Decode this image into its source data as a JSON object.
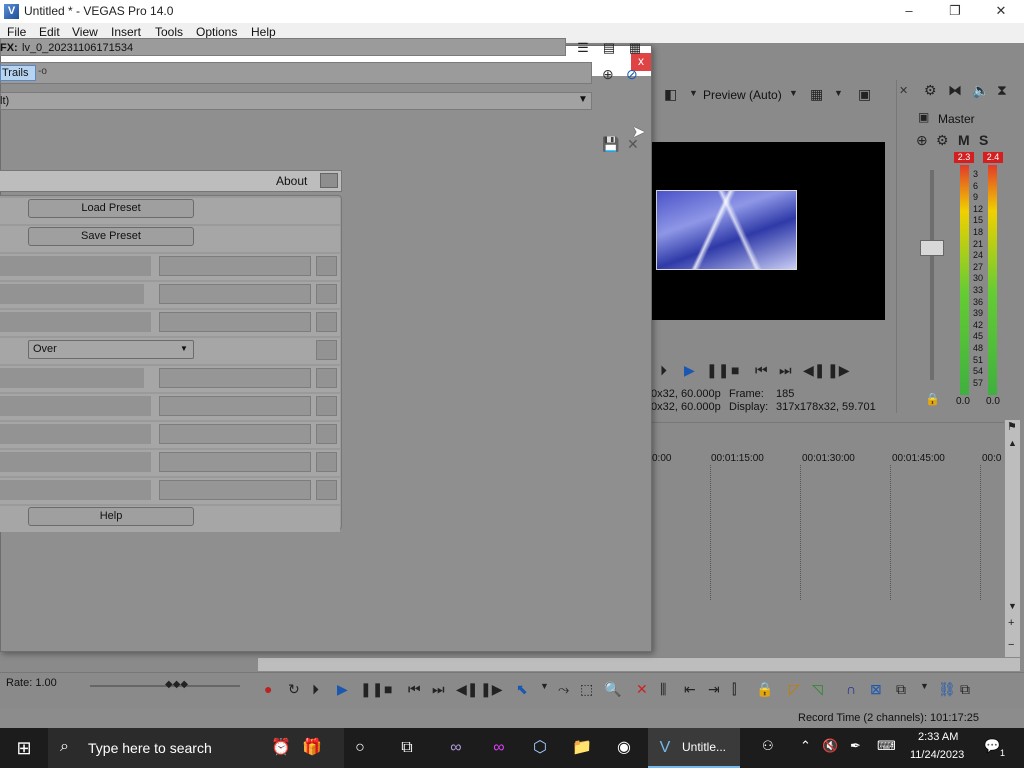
{
  "window": {
    "title": "Untitled * - VEGAS Pro 14.0",
    "app_icon_glyph": "V",
    "minimize": "–",
    "maximize": "❐",
    "close": "✕"
  },
  "menu": [
    "File",
    "Edit",
    "View",
    "Insert",
    "Tools",
    "Options",
    "Help"
  ],
  "fx_dialog": {
    "close": "x",
    "fx_label": "FX:",
    "chain_name": "lv_0_20231106171534",
    "plugin_chip": "Trails",
    "plugin_plug_glyph": "-o",
    "preset_value": "lt)",
    "preset_arrow": "▼",
    "about": "About",
    "load_preset": "Load Preset",
    "save_preset": "Save Preset",
    "blend_mode": "Over",
    "help": "Help"
  },
  "preview": {
    "mode": "Preview (Auto)",
    "frame_label": "Frame:",
    "frame_value": "185",
    "display_label": "Display:",
    "display_value": "317x178x32, 59.701",
    "project_left_1": "0x32, 60.000p",
    "project_left_2": "0x32, 60.000p"
  },
  "master": {
    "label": "Master",
    "m": "M",
    "s": "S",
    "peak_left": "2.3",
    "peak_right": "2.4",
    "scale": [
      "3",
      "6",
      "9",
      "12",
      "15",
      "18",
      "21",
      "24",
      "27",
      "30",
      "33",
      "36",
      "39",
      "42",
      "45",
      "48",
      "51",
      "54",
      "57"
    ],
    "bottom_left": "0.0",
    "bottom_right": "0.0"
  },
  "timeline": {
    "ticks": [
      "0:00",
      "00:01:15:00",
      "00:01:30:00",
      "00:01:45:00",
      "00:0"
    ]
  },
  "transport": {
    "rate": "Rate: 1.00",
    "record_time": "Record Time (2 channels): 101:17:25"
  },
  "taskbar": {
    "search_placeholder": "Type here to search",
    "vegas_label": "Untitle...",
    "time": "2:33 AM",
    "date": "11/24/2023",
    "notification_count": "1"
  }
}
